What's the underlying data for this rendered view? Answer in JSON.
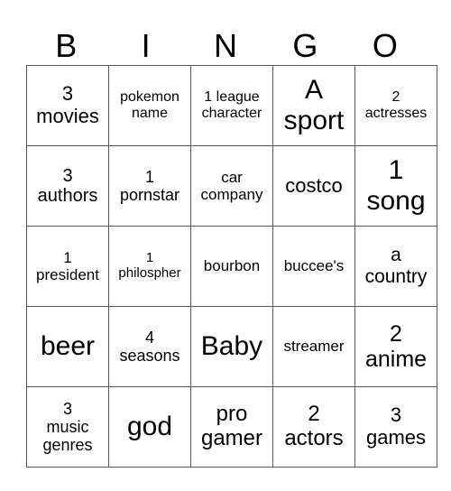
{
  "header": [
    "B",
    "I",
    "N",
    "G",
    "O"
  ],
  "rows": [
    [
      {
        "text": "3\nmovies",
        "size": 22
      },
      {
        "text": "pokemon\nname",
        "size": 16
      },
      {
        "text": "1 league\ncharacter",
        "size": 16
      },
      {
        "text": "A\nsport",
        "size": 30
      },
      {
        "text": "2\nactresses",
        "size": 16
      }
    ],
    [
      {
        "text": "3\nauthors",
        "size": 20
      },
      {
        "text": "1\npornstar",
        "size": 18
      },
      {
        "text": "car\ncompany",
        "size": 17
      },
      {
        "text": "costco",
        "size": 22
      },
      {
        "text": "1\nsong",
        "size": 30
      }
    ],
    [
      {
        "text": "1\npresident",
        "size": 17
      },
      {
        "text": "1\nphilospher",
        "size": 15
      },
      {
        "text": "bourbon",
        "size": 17
      },
      {
        "text": "buccee's",
        "size": 17
      },
      {
        "text": "a\ncountry",
        "size": 21
      }
    ],
    [
      {
        "text": "beer",
        "size": 30
      },
      {
        "text": "4\nseasons",
        "size": 18
      },
      {
        "text": "Baby",
        "size": 30
      },
      {
        "text": "streamer",
        "size": 17
      },
      {
        "text": "2\nanime",
        "size": 25
      }
    ],
    [
      {
        "text": "3\nmusic\ngenres",
        "size": 18
      },
      {
        "text": "god",
        "size": 30
      },
      {
        "text": "pro\ngamer",
        "size": 24
      },
      {
        "text": "2\nactors",
        "size": 24
      },
      {
        "text": "3\ngames",
        "size": 22
      }
    ]
  ]
}
